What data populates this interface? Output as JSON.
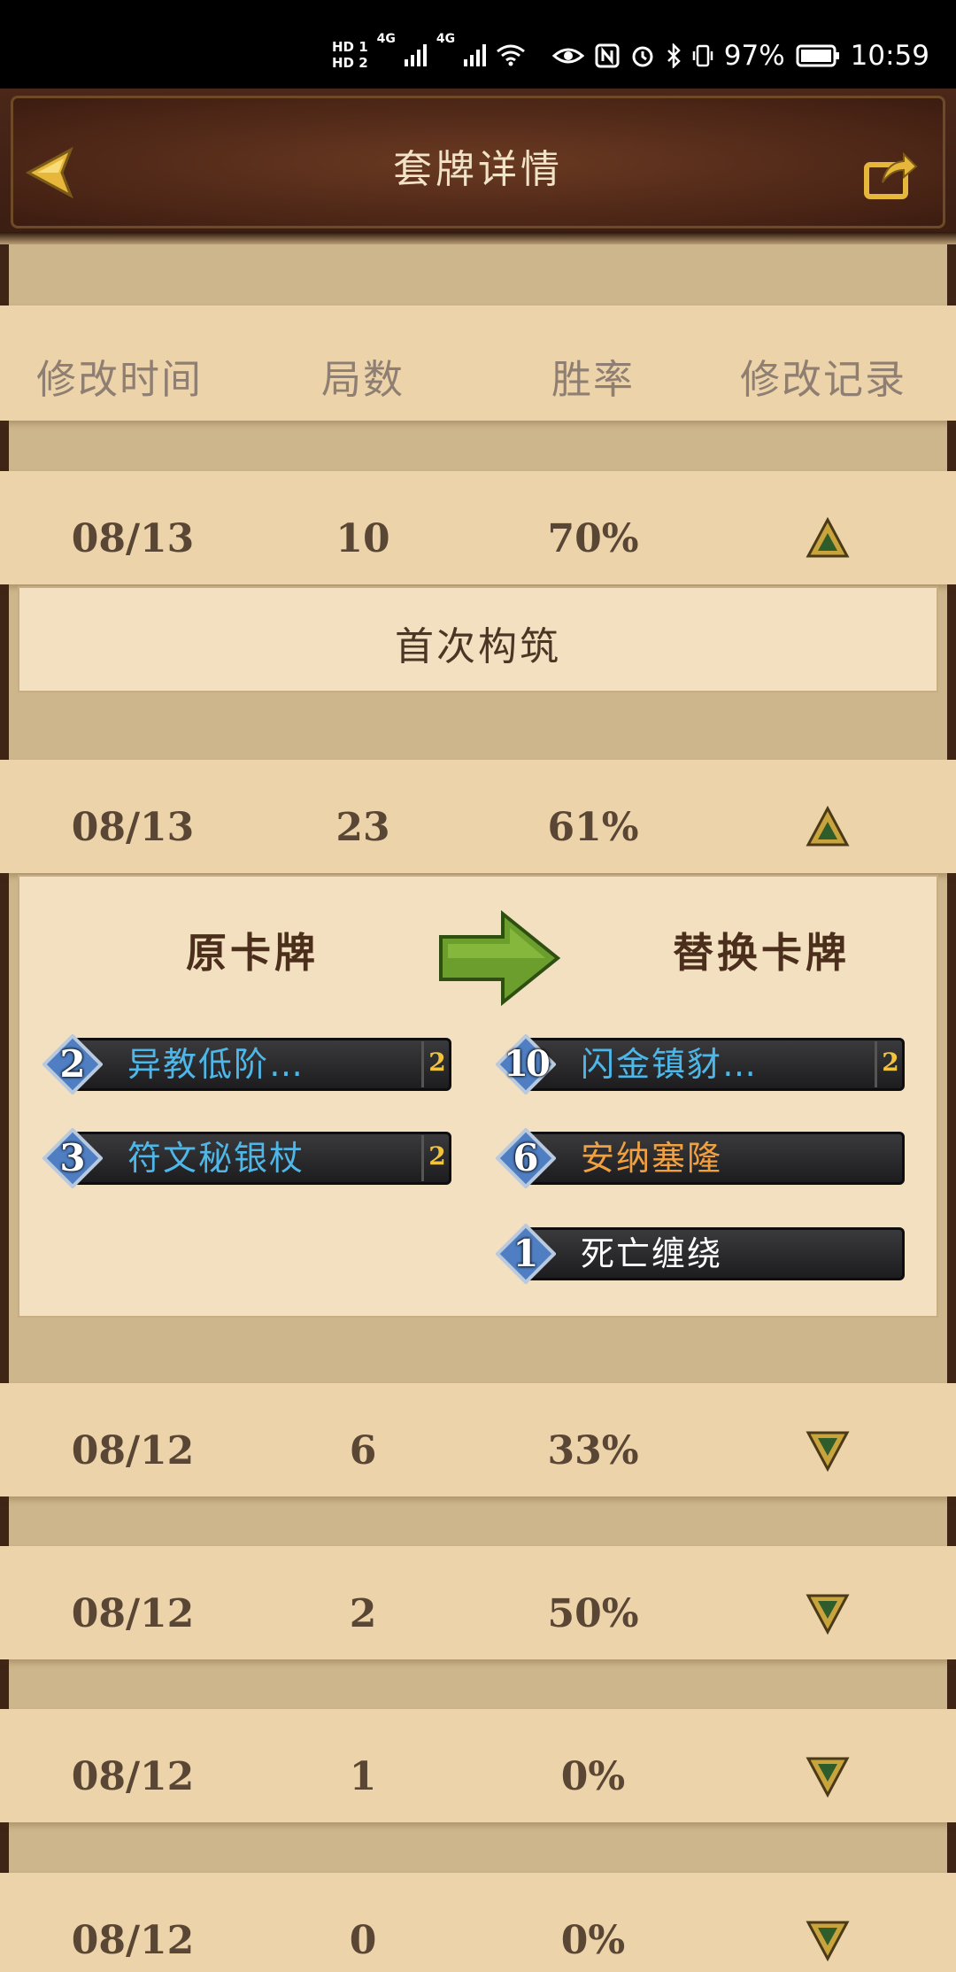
{
  "status_bar": {
    "hd_top": "HD 1",
    "hd_bottom": "HD 2",
    "net1": "4G",
    "net2": "4G",
    "battery": "97%",
    "time": "10:59"
  },
  "header": {
    "title": "套牌详情",
    "back_icon": "back-arrow-icon",
    "share_icon": "share-icon"
  },
  "columns": [
    "修改时间",
    "局数",
    "胜率",
    "修改记录"
  ],
  "rows": [
    {
      "date": "08/13",
      "games": "10",
      "winrate": "70%",
      "toggle": "up"
    },
    {
      "date": "08/13",
      "games": "23",
      "winrate": "61%",
      "toggle": "up"
    },
    {
      "date": "08/12",
      "games": "6",
      "winrate": "33%",
      "toggle": "down"
    },
    {
      "date": "08/12",
      "games": "2",
      "winrate": "50%",
      "toggle": "down"
    },
    {
      "date": "08/12",
      "games": "1",
      "winrate": "0%",
      "toggle": "down"
    },
    {
      "date": "08/12",
      "games": "0",
      "winrate": "0%",
      "toggle": "down"
    }
  ],
  "first_build": {
    "text": "首次构筑"
  },
  "changes": {
    "original_title": "原卡牌",
    "replacement_title": "替换卡牌",
    "original": [
      {
        "cost": "2",
        "name": "异教低阶…",
        "count": "2",
        "rarity_color": "#4fb7e8"
      },
      {
        "cost": "3",
        "name": "符文秘银杖",
        "count": "2",
        "rarity_color": "#4fb7e8"
      }
    ],
    "replacement": [
      {
        "cost": "10",
        "name": "闪金镇豺…",
        "count": "2",
        "rarity_color": "#4fb7e8"
      },
      {
        "cost": "6",
        "name": "安纳塞隆",
        "count": "",
        "rarity_color": "#f0a040"
      },
      {
        "cost": "1",
        "name": "死亡缠绕",
        "count": "",
        "rarity_color": "#ffffff"
      }
    ]
  }
}
